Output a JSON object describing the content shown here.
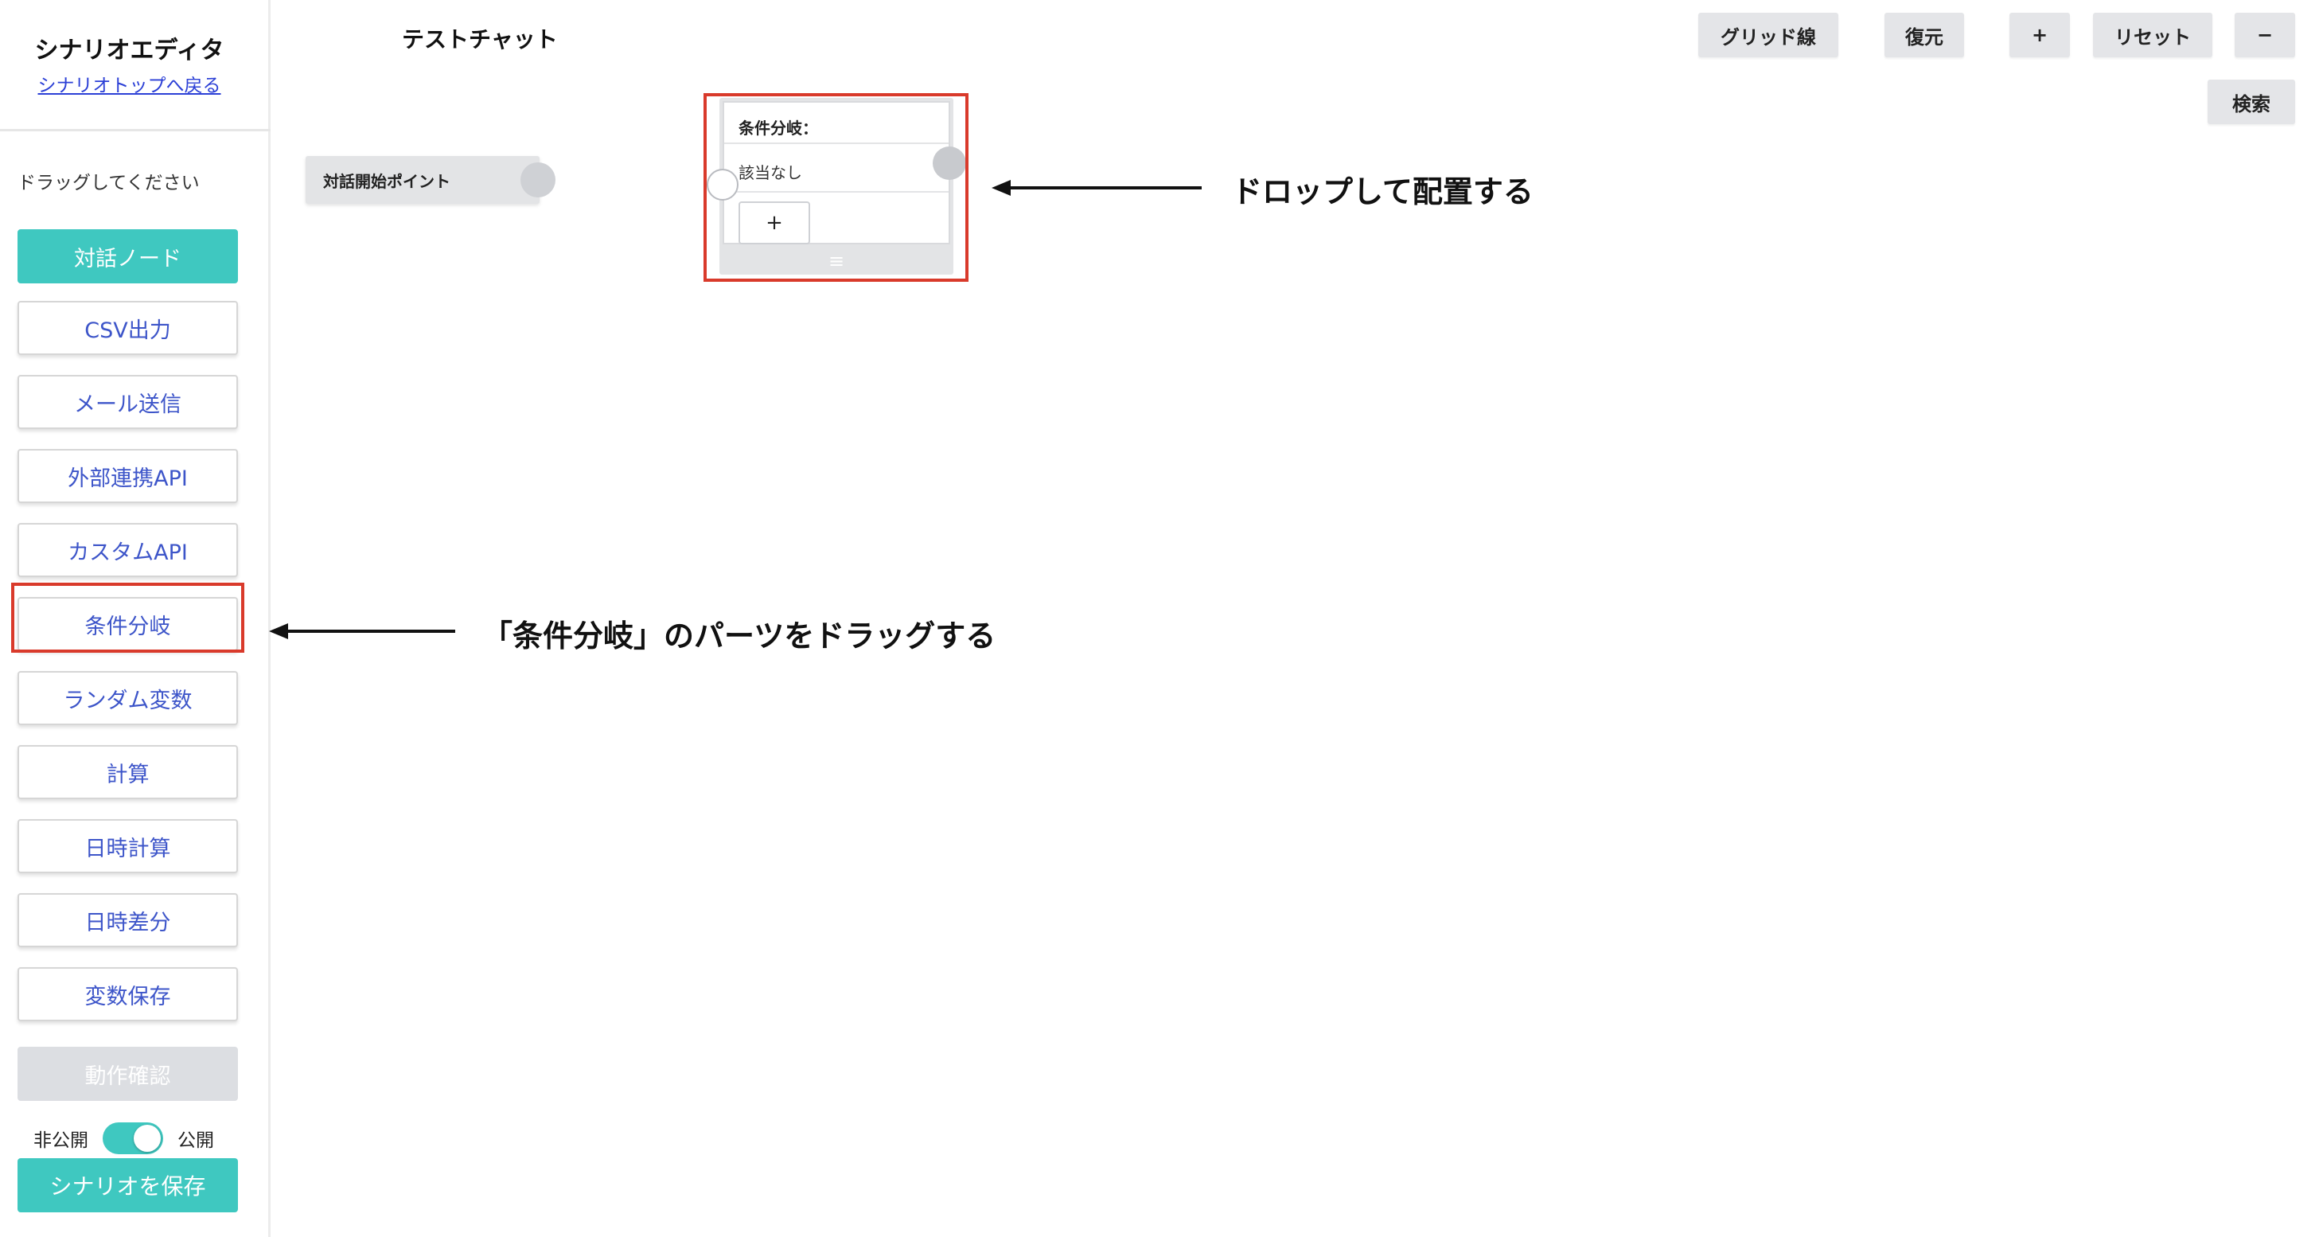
{
  "sidebar": {
    "title": "シナリオエディタ",
    "back_link": "シナリオトップへ戻る",
    "hint": "ドラッグしてください",
    "parts": [
      {
        "label": "対話ノード",
        "style": "primary"
      },
      {
        "label": "CSV出力",
        "style": "default"
      },
      {
        "label": "メール送信",
        "style": "default"
      },
      {
        "label": "外部連携API",
        "style": "default"
      },
      {
        "label": "カスタムAPI",
        "style": "default"
      },
      {
        "label": "条件分岐",
        "style": "default"
      },
      {
        "label": "ランダム変数",
        "style": "default"
      },
      {
        "label": "計算",
        "style": "default"
      },
      {
        "label": "日時計算",
        "style": "default"
      },
      {
        "label": "日時差分",
        "style": "default"
      },
      {
        "label": "変数保存",
        "style": "default"
      },
      {
        "label": "動作確認",
        "style": "disabled"
      }
    ],
    "visibility": {
      "private_label": "非公開",
      "public_label": "公開",
      "state": "public"
    },
    "save_label": "シナリオを保存"
  },
  "toolbar": {
    "canvas_title": "テストチャット",
    "grid_label": "グリッド線",
    "restore_label": "復元",
    "zoom_in_label": "+",
    "reset_label": "リセット",
    "zoom_out_label": "−",
    "search_label": "検索"
  },
  "canvas": {
    "start_node_label": "対話開始ポイント",
    "condition_node": {
      "header": "条件分岐：",
      "default_row": "該当なし",
      "add_label": "+",
      "grip": "≡"
    }
  },
  "annotations": {
    "drop": "ドロップして配置する",
    "drag": "「条件分岐」のパーツをドラッグする"
  },
  "colors": {
    "accent": "#3fc8c0",
    "link": "#2b3fd6",
    "part_text": "#3d55c9",
    "highlight": "#d93a2b",
    "toolbar_button": "#e4e5e8"
  }
}
